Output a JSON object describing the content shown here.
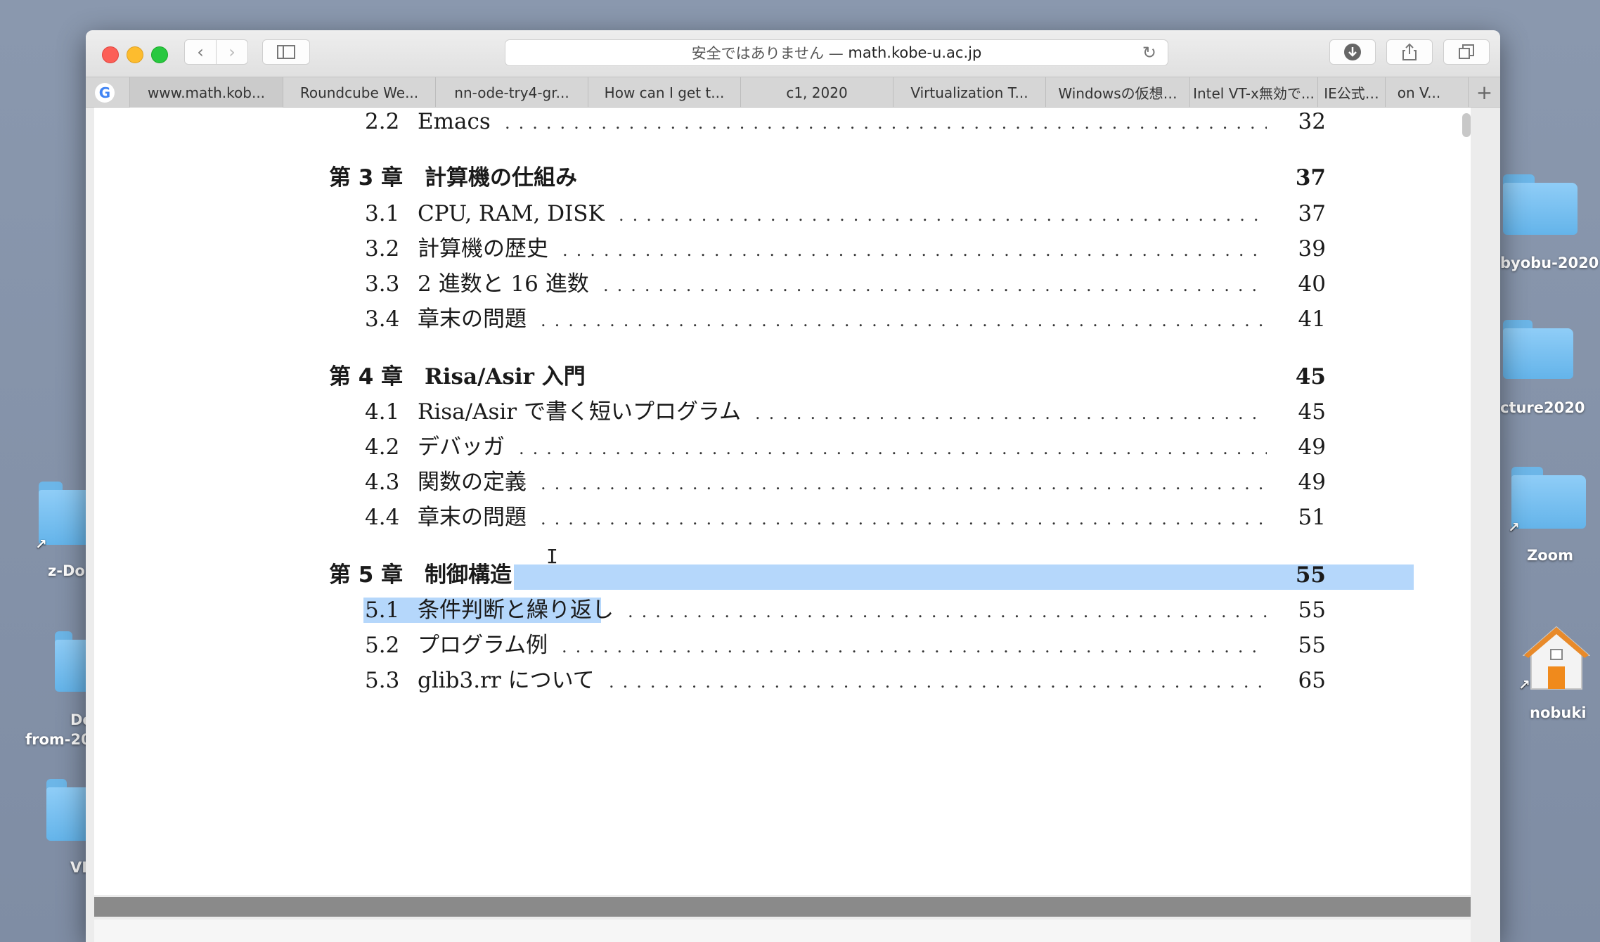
{
  "desktop": {
    "right_icons": [
      {
        "label": "byobu-2020"
      },
      {
        "label": "cture2020"
      },
      {
        "label": "Zoom"
      },
      {
        "label": "nobuki"
      }
    ],
    "left_icons": [
      {
        "label": "z-Do"
      },
      {
        "label": "Do",
        "label2": "from-20"
      },
      {
        "label": "VI"
      }
    ]
  },
  "browser": {
    "url_prefix": "安全ではありません —",
    "url_host": "math.kobe-u.ac.jp",
    "tabs": [
      "www.math.kob...",
      "Roundcube We...",
      "nn-ode-try4-gr...",
      "How can I get t...",
      "c1, 2020",
      "Virtualization T...",
      "Windowsの仮想…",
      "Intel VT-x無効で...",
      "IE公式…",
      "on V..."
    ],
    "new_tab_label": "+"
  },
  "toc": {
    "rows": [
      {
        "kind": "sec",
        "num": "2.2",
        "title": "Emacs",
        "page": "32"
      },
      {
        "kind": "chap",
        "num": "第 3 章",
        "title": "計算機の仕組み",
        "page": "37"
      },
      {
        "kind": "sec",
        "num": "3.1",
        "title": "CPU, RAM, DISK",
        "page": "37"
      },
      {
        "kind": "sec",
        "num": "3.2",
        "title": "計算機の歴史",
        "page": "39"
      },
      {
        "kind": "sec",
        "num": "3.3",
        "title": "2 進数と 16 進数",
        "page": "40"
      },
      {
        "kind": "sec",
        "num": "3.4",
        "title": "章末の問題",
        "page": "41"
      },
      {
        "kind": "chap",
        "num": "第 4 章",
        "title": "Risa/Asir 入門",
        "page": "45"
      },
      {
        "kind": "sec",
        "num": "4.1",
        "title": "Risa/Asir で書く短いプログラム",
        "page": "45"
      },
      {
        "kind": "sec",
        "num": "4.2",
        "title": "デバッガ",
        "page": "49"
      },
      {
        "kind": "sec",
        "num": "4.3",
        "title": "関数の定義",
        "page": "49"
      },
      {
        "kind": "sec",
        "num": "4.4",
        "title": "章末の問題",
        "page": "51"
      },
      {
        "kind": "chap",
        "num": "第 5 章",
        "title": "制御構造",
        "page": "55"
      },
      {
        "kind": "sec",
        "num": "5.1",
        "title": "条件判断と繰り返し",
        "page": "55"
      },
      {
        "kind": "sec",
        "num": "5.2",
        "title": "プログラム例",
        "page": "55"
      },
      {
        "kind": "sec",
        "num": "5.3",
        "title": "glib3.rr について",
        "page": "65"
      }
    ]
  }
}
